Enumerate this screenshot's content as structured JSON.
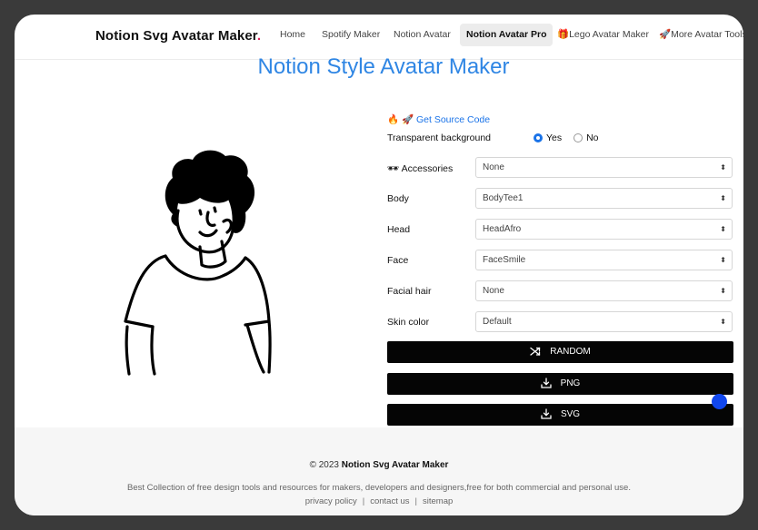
{
  "nav": {
    "brand": "Notion Svg Avatar Maker",
    "brand_dot": ".",
    "items": [
      {
        "label": "Home",
        "active": false
      },
      {
        "label": "Spotify Maker",
        "active": false
      },
      {
        "label": "Notion Avatar",
        "active": false
      },
      {
        "label": "Notion Avatar Pro",
        "active": true
      },
      {
        "label": "🎁Lego Avatar Maker",
        "active": false
      },
      {
        "label": "🚀More Avatar Tools",
        "active": false
      }
    ]
  },
  "page_title": "Notion Style Avatar Maker",
  "form": {
    "source_link": "🔥 🚀 Get Source Code",
    "transparent_label": "Transparent background",
    "transparent_options": [
      {
        "label": "Yes",
        "checked": true
      },
      {
        "label": "No",
        "checked": false
      }
    ],
    "fields": [
      {
        "label": "🕶 Accessories",
        "value": "None"
      },
      {
        "label": "Body",
        "value": "BodyTee1"
      },
      {
        "label": "Head",
        "value": "HeadAfro"
      },
      {
        "label": "Face",
        "value": "FaceSmile"
      },
      {
        "label": "Facial hair",
        "value": "None"
      },
      {
        "label": "Skin color",
        "value": "Default"
      }
    ],
    "buttons": {
      "random": "RANDOM",
      "png": "PNG",
      "svg": "SVG"
    }
  },
  "footer": {
    "copyright_prefix": "© 2023",
    "copyright_name": "Notion Svg Avatar Maker",
    "description": "Best Collection of free design tools and resources for makers, developers and designers,free for both commercial and personal use.",
    "links": [
      "privacy policy",
      "contact us",
      "sitemap"
    ]
  },
  "colors": {
    "title": "#2f86e4",
    "link": "#1a73e8",
    "button_bg": "#050505",
    "indicator": "#1147ee"
  }
}
